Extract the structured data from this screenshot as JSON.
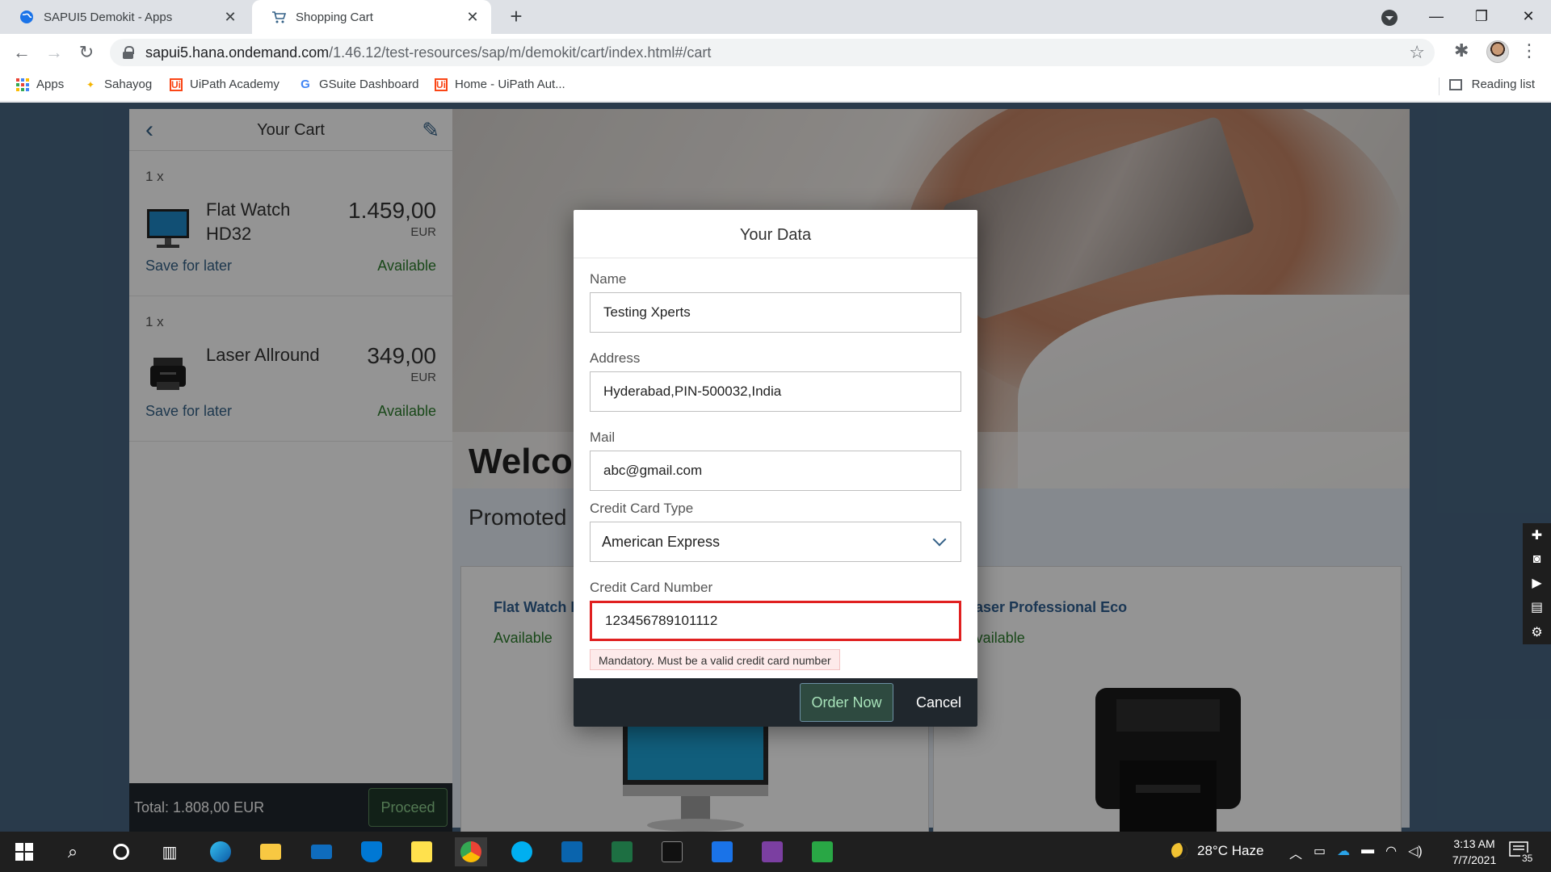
{
  "browser": {
    "tabs": [
      {
        "title": "SAPUI5 Demokit - Apps",
        "active": false
      },
      {
        "title": "Shopping Cart",
        "active": true
      }
    ],
    "url_host": "sapui5.hana.ondemand.com",
    "url_path": "/1.46.12/test-resources/sap/m/demokit/cart/index.html#/cart",
    "bookmarks": [
      "Apps",
      "Sahayog",
      "UiPath Academy",
      "GSuite Dashboard",
      "Home - UiPath Aut..."
    ],
    "reading_list": "Reading list"
  },
  "cart": {
    "title": "Your Cart",
    "items": [
      {
        "qty": "1 x",
        "name": "Flat Watch HD32",
        "price": "1.459,00",
        "currency": "EUR",
        "save": "Save for later",
        "status": "Available"
      },
      {
        "qty": "1 x",
        "name": "Laser Allround",
        "price": "349,00",
        "currency": "EUR",
        "save": "Save for later",
        "status": "Available"
      }
    ],
    "total": "Total: 1.808,00 EUR",
    "proceed": "Proceed"
  },
  "main": {
    "welcome": "Welcome",
    "promoted": "Promoted",
    "promos": [
      {
        "name": "Flat Watch HD32",
        "status": "Available"
      },
      {
        "name": "Laser Professional Eco",
        "status": "Available"
      }
    ]
  },
  "dialog": {
    "title": "Your Data",
    "fields": {
      "name": {
        "label": "Name",
        "value": "Testing Xperts"
      },
      "address": {
        "label": "Address",
        "value": "Hyderabad,PIN-500032,India"
      },
      "mail": {
        "label": "Mail",
        "value": "abc@gmail.com"
      },
      "cc_type": {
        "label": "Credit Card Type",
        "value": "American Express"
      },
      "cc_number": {
        "label": "Credit Card Number",
        "value": "123456789101112"
      }
    },
    "error": "Mandatory. Must be a valid credit card number",
    "order": "Order Now",
    "cancel": "Cancel"
  },
  "taskbar": {
    "weather": "28°C  Haze",
    "time": "3:13 AM",
    "date": "7/7/2021",
    "notifications": "35"
  },
  "colors": {
    "accent": "#346187",
    "available": "#2b7c2b",
    "error": "#e02020",
    "footer": "#20272d"
  }
}
